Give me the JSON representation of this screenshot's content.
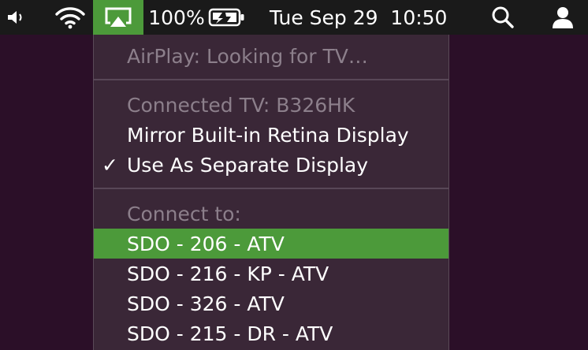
{
  "menubar": {
    "battery_text": "100%",
    "datetime": "Tue Sep 29  10:50",
    "icons": {
      "volume": "speaker-icon",
      "wifi": "wifi-icon",
      "airplay": "airplay-icon",
      "battery": "battery-charging-icon",
      "search": "search-icon",
      "user": "user-icon"
    },
    "accent_color": "#4c9a3a"
  },
  "airplay_menu": {
    "status": "AirPlay: Looking for TV…",
    "connected_tv": "Connected TV: B326HK",
    "mirror_option": "Mirror Built-in Retina Display",
    "separate_option": "Use As Separate Display",
    "separate_checkmark": "✓",
    "connect_to_label": "Connect to:",
    "devices": [
      "SDO - 206 - ATV",
      "SDO - 216 - KP - ATV",
      "SDO - 326 - ATV",
      "SDO - 215 - DR - ATV"
    ],
    "highlighted_device": "SDO - 206 - ATV"
  }
}
